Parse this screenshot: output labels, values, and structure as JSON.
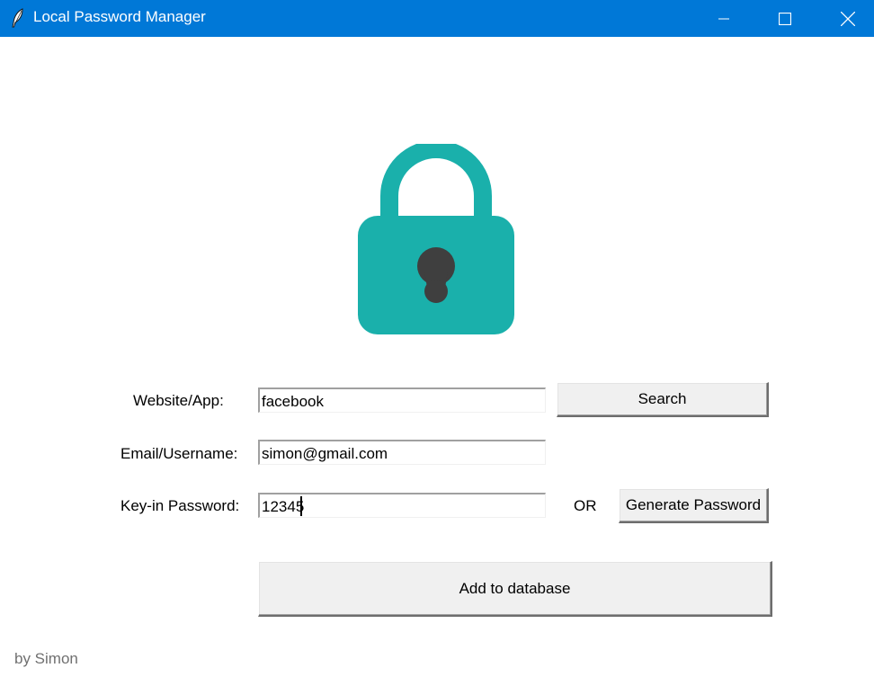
{
  "window": {
    "title": "Local Password Manager",
    "icon": "feather-icon",
    "controls": [
      "minimize-icon",
      "maximize-icon",
      "close-icon"
    ],
    "titlebar_color": "#0078d7"
  },
  "logo": {
    "icon": "padlock-icon",
    "body_color": "#1ab0ab",
    "keyhole_color": "#3f3f3f"
  },
  "form": {
    "website_label": "Website/App:",
    "website_value": "facebook",
    "search_label": "Search",
    "email_label": "Email/Username:",
    "email_value": "simon@gmail.com",
    "password_label": "Key-in Password:",
    "password_value": "12345",
    "or_label": "OR",
    "generate_label": "Generate Password",
    "add_label": "Add to database"
  },
  "footer": {
    "credit": "by Simon"
  }
}
